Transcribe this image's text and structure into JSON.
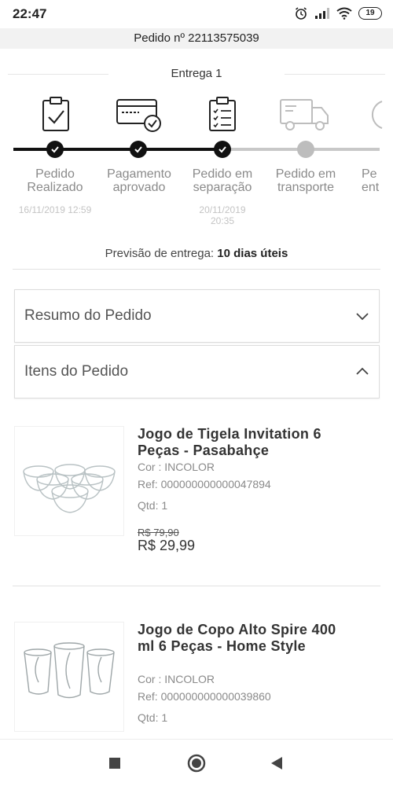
{
  "status_bar": {
    "time": "22:47",
    "battery": "19",
    "icons": [
      "alarm-icon",
      "signal-icon",
      "wifi-icon",
      "battery-icon"
    ]
  },
  "order": {
    "number_label": "Pedido nº 22113575039"
  },
  "delivery": {
    "title": "Entrega 1",
    "steps": [
      {
        "label_line1": "Pedido",
        "label_line2": "Realizado",
        "date_line1": "16/11/2019 12:59",
        "date_line2": "",
        "status": "done",
        "icon": "clipboard-check-icon"
      },
      {
        "label_line1": "Pagamento",
        "label_line2": "aprovado",
        "date_line1": "",
        "date_line2": "",
        "status": "done",
        "icon": "credit-card-check-icon"
      },
      {
        "label_line1": "Pedido em",
        "label_line2": "separação",
        "date_line1": "20/11/2019",
        "date_line2": "20:35",
        "status": "done",
        "icon": "checklist-icon"
      },
      {
        "label_line1": "Pedido em",
        "label_line2": "transporte",
        "date_line1": "",
        "date_line2": "",
        "status": "pending",
        "icon": "truck-icon"
      },
      {
        "label_line1": "Pe",
        "label_line2": "ent",
        "date_line1": "",
        "date_line2": "",
        "status": "pending",
        "icon": "clock-icon"
      }
    ],
    "forecast_label": "Previsão de entrega:",
    "forecast_value": "10 dias úteis"
  },
  "accordions": {
    "summary": {
      "label": "Resumo do Pedido",
      "state": "collapsed"
    },
    "items": {
      "label": "Itens do Pedido",
      "state": "expanded"
    }
  },
  "products": [
    {
      "name": "Jogo de Tigela Invitation 6 Peças - Pasabahçe",
      "color": "Cor : INCOLOR",
      "ref": "Ref: 000000000000047894",
      "qty": "Qtd: 1",
      "old_price": "R$ 79,90",
      "price": "R$ 29,99"
    },
    {
      "name": "Jogo de Copo Alto Spire 400 ml 6 Peças - Home Style",
      "color": "Cor : INCOLOR",
      "ref": "Ref: 000000000000039860",
      "qty": "Qtd: 1"
    }
  ],
  "nav": {
    "icons": [
      "recent-apps-icon",
      "home-icon",
      "back-icon"
    ]
  }
}
